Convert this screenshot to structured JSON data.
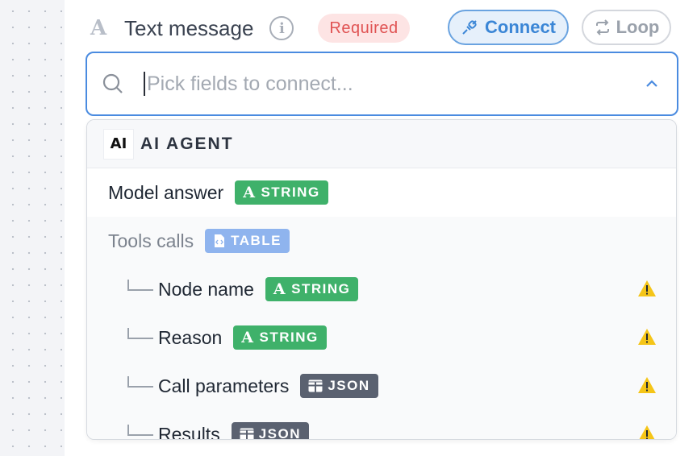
{
  "field": {
    "type_icon": "A",
    "label": "Text message",
    "info_icon": "i",
    "required_label": "Required"
  },
  "actions": {
    "connect_label": "Connect",
    "loop_label": "Loop"
  },
  "search": {
    "placeholder": "Pick fields to connect...",
    "value": ""
  },
  "dropdown": {
    "group": {
      "logo_text": "AI",
      "title": "AI AGENT"
    },
    "items": [
      {
        "label": "Model answer",
        "type": "STRING"
      },
      {
        "label": "Tools calls",
        "type": "TABLE"
      },
      {
        "label": "Node name",
        "type": "STRING"
      },
      {
        "label": "Reason",
        "type": "STRING"
      },
      {
        "label": "Call parameters",
        "type": "JSON"
      },
      {
        "label": "Results",
        "type": "JSON"
      }
    ]
  },
  "colors": {
    "accent": "#4a8be0",
    "string_badge": "#3fb16a",
    "table_badge": "#8fb4ee",
    "json_badge": "#5a6170",
    "required": "#e05353",
    "warning": "#f5c518"
  }
}
